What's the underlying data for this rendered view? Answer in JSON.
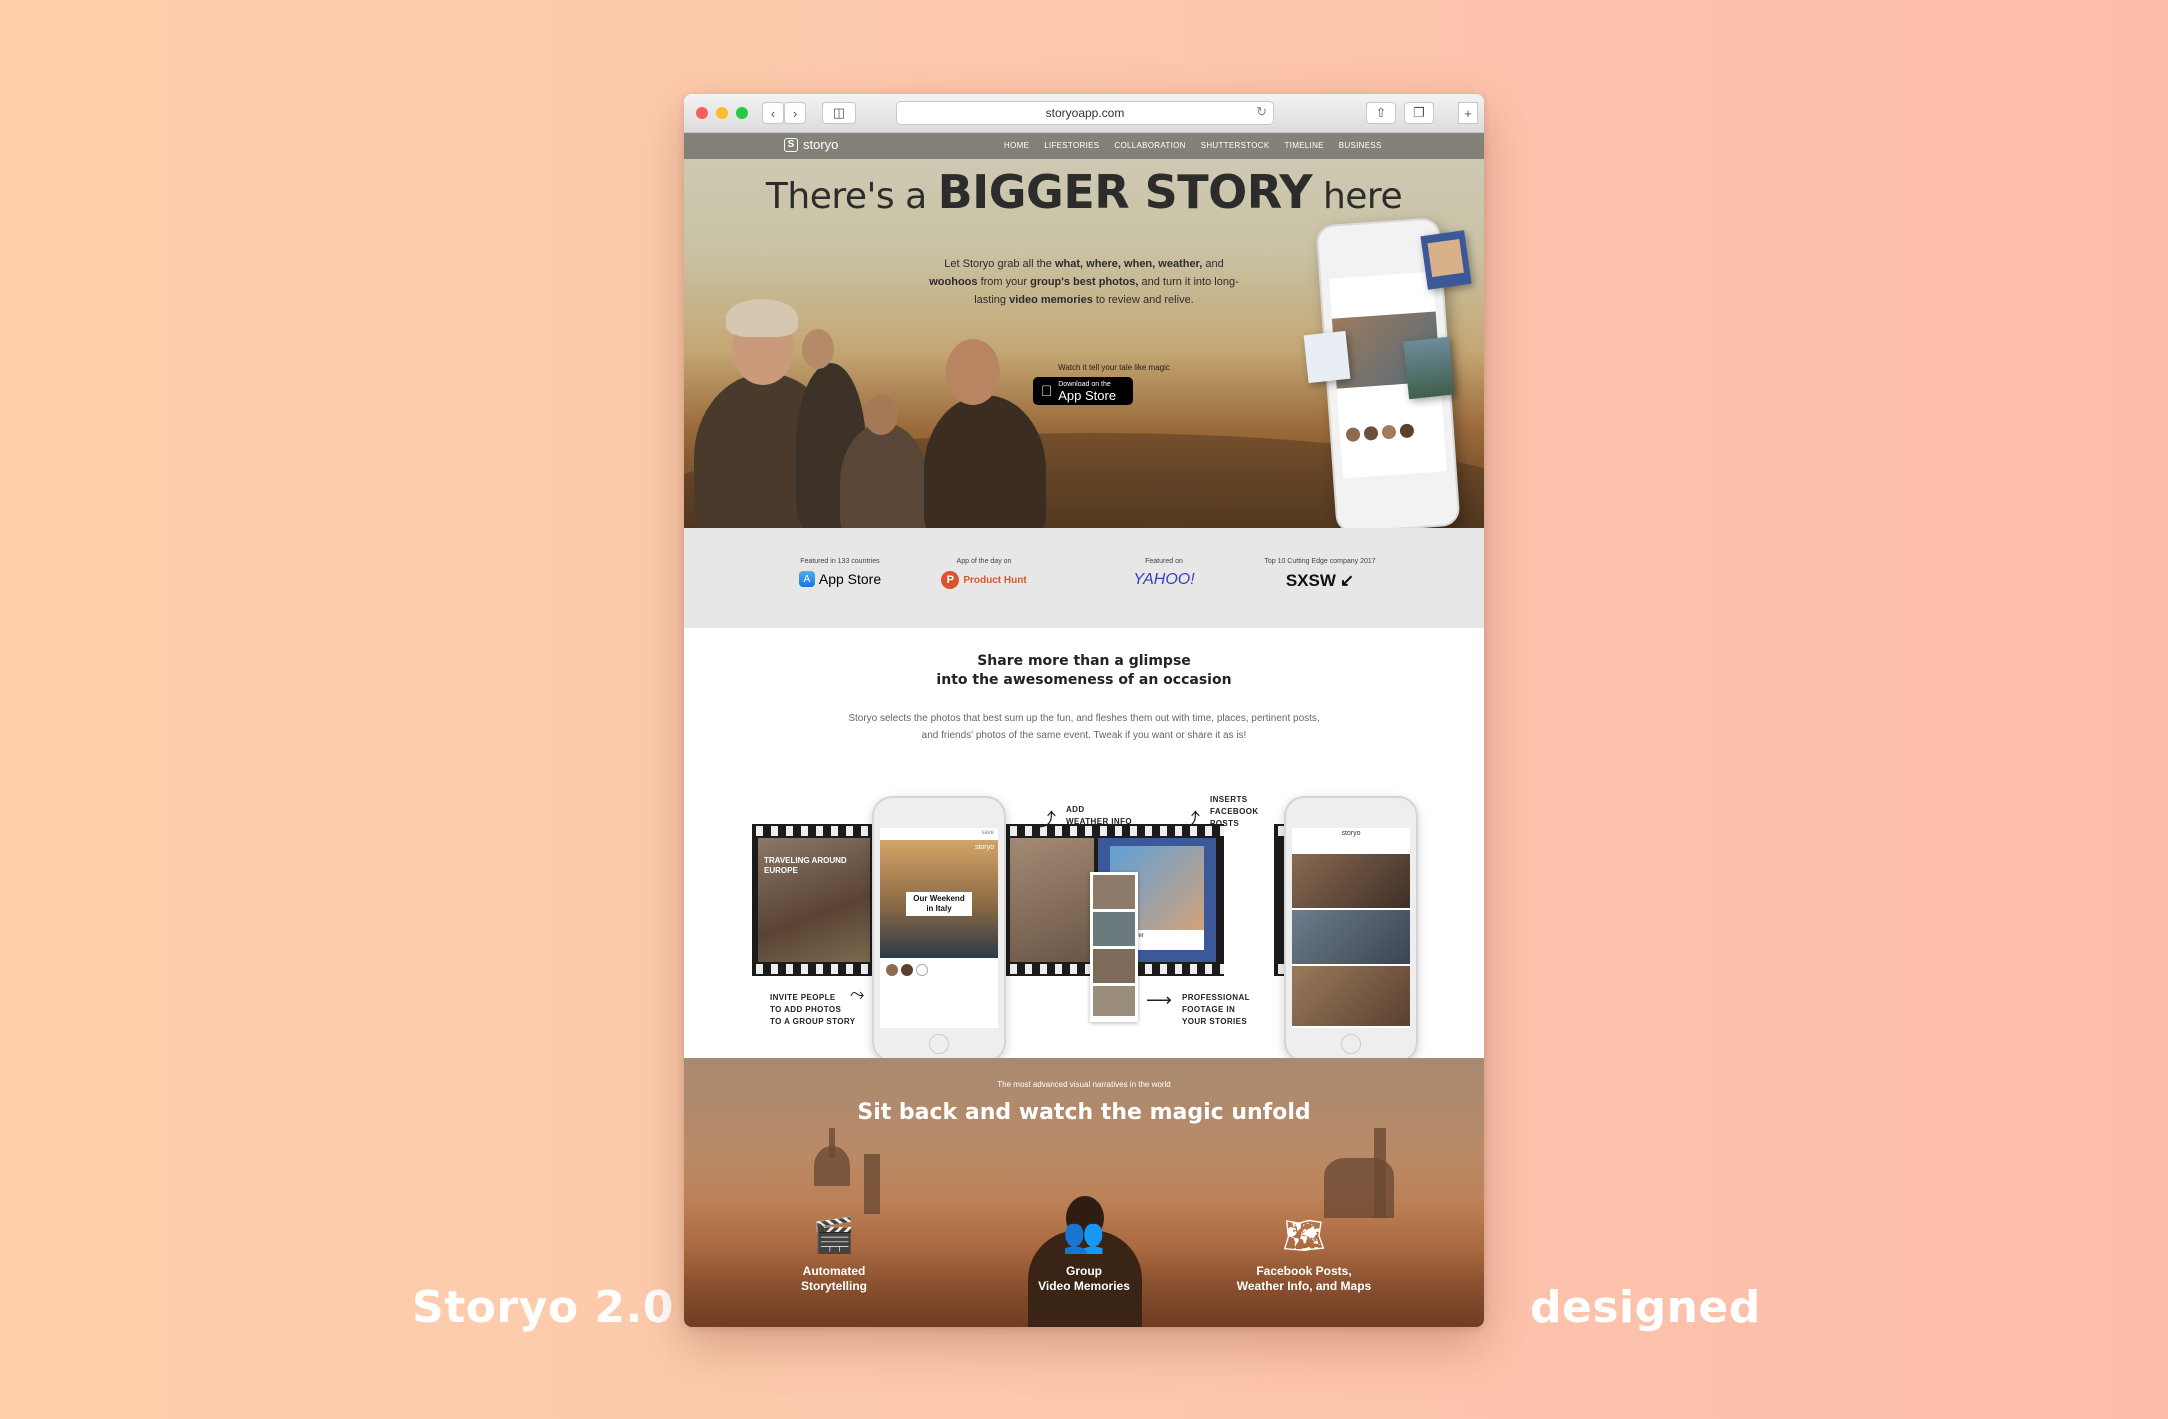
{
  "captions": {
    "left": "Storyo 2.0",
    "right": "designed"
  },
  "browser": {
    "url": "storyoapp.com"
  },
  "nav": {
    "brand": "storyo",
    "items": [
      "HOME",
      "LIFESTORIES",
      "COLLABORATION",
      "SHUTTERSTOCK",
      "TIMELINE",
      "BUSINESS"
    ]
  },
  "hero": {
    "headline_pre": "There's a",
    "headline_big": "BIGGER STORY",
    "headline_post": "here",
    "intro": {
      "p1": "Let Storyo grab all the ",
      "b1": "what, where, when, weather,",
      "p2": " and ",
      "b2": "woohoos",
      "p3": " from your ",
      "b3": "group's best photos,",
      "p4": " and turn it into long-lasting ",
      "b4": "video memories",
      "p5": " to review and relive."
    },
    "watch": "Watch it tell your tale like magic",
    "appstore_small": "Download on the",
    "appstore_big": "App Store"
  },
  "featured": [
    {
      "label": "Featured in 133 countries",
      "logo": "App Store"
    },
    {
      "label": "App of the day on",
      "logo": "Product Hunt"
    },
    {
      "label": "Featured on",
      "logo": "YAHOO!"
    },
    {
      "label": "Top 10 Cutting Edge company 2017",
      "logo": "SXSW"
    }
  ],
  "share": {
    "title_l1": "Share more than a glimpse",
    "title_l2": "into the awesomeness of an occasion",
    "sub": "Storyo selects the photos that best sum up the fun, and fleshes them out with time, places, pertinent posts, and friends' photos of the same event. Tweak if you want or share it as is!",
    "notes": {
      "weather": "ADD\nWEATHER INFO",
      "facebook": "INSERTS\nFACEBOOK\nPOSTS",
      "invite": "INVITE PEOPLE\nTO ADD PHOTOS\nTO A GROUP STORY",
      "footage": "PROFESSIONAL\nFOOTAGE IN\nYOUR STORIES"
    },
    "phone1": {
      "title": "Our Weekend\nin Italy",
      "brand": "storyo",
      "save": "save"
    },
    "phone2": {
      "brand": "storyo"
    },
    "frame_title": "TRAVELING AROUND\nEUROPE",
    "fb_name": "Eiffel Tower"
  },
  "magic": {
    "kicker": "The most advanced visual narratives in the world",
    "title": "Sit back and watch the magic unfold",
    "features": [
      {
        "icon": "clapperboard-icon",
        "label": "Automated\nStorytelling"
      },
      {
        "icon": "group-film-icon",
        "label": "Group\nVideo Memories"
      },
      {
        "icon": "map-pin-icon",
        "label": "Facebook Posts,\nWeather Info, and Maps"
      }
    ]
  },
  "colors": {
    "background_left": "#fdd0ab",
    "background_right": "#fcbca9",
    "producthunt": "#da552f",
    "facebook_blue": "#3b5998"
  }
}
